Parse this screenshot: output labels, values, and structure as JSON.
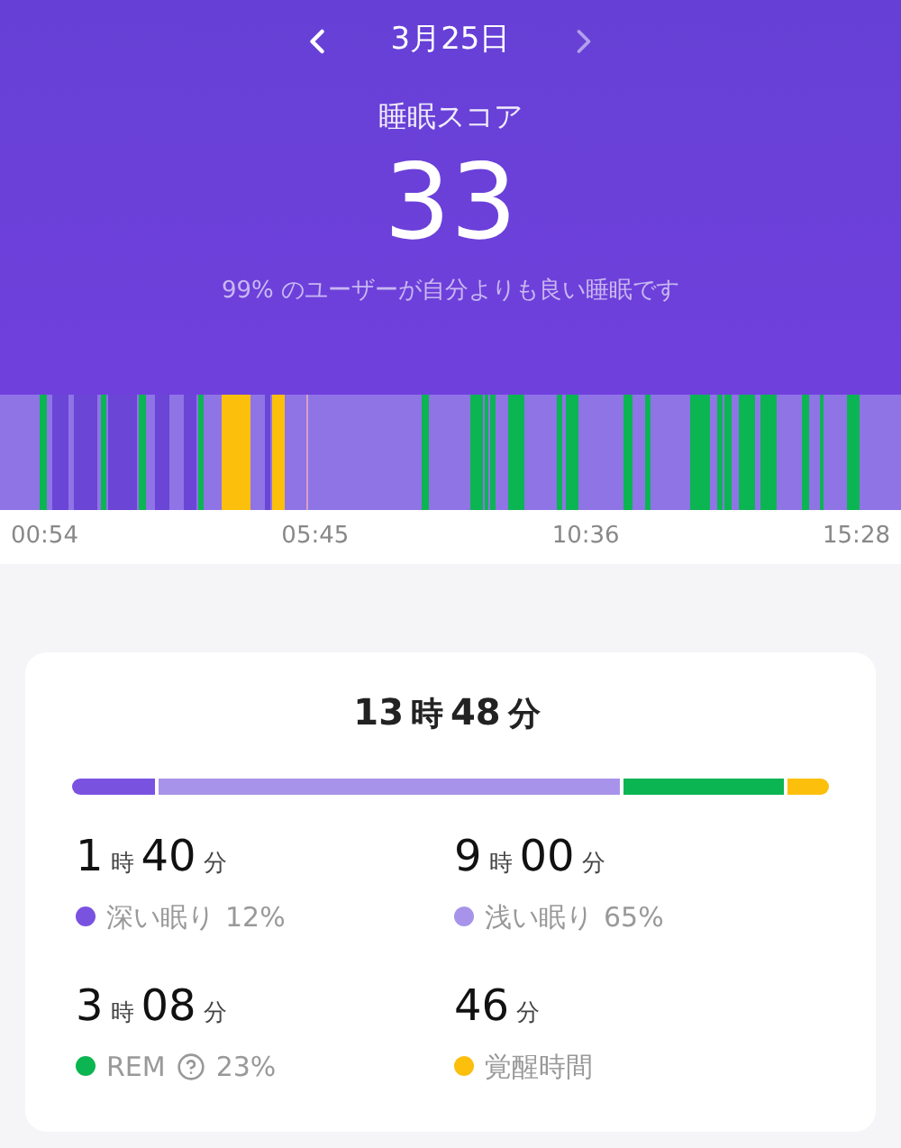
{
  "header": {
    "date": "3月25日",
    "score_label": "睡眠スコア",
    "score": "33",
    "comparison": "99% のユーザーが自分よりも良い睡眠です"
  },
  "timeline": {
    "times": [
      "00:54",
      "05:45",
      "10:36",
      "15:28"
    ]
  },
  "summary": {
    "total": [
      {
        "kind": "number",
        "text": "13"
      },
      {
        "kind": "unit",
        "text": "時"
      },
      {
        "kind": "number",
        "text": "48"
      },
      {
        "kind": "unit",
        "text": "分"
      }
    ],
    "stages": [
      {
        "name": "深い眠り",
        "percent": "12%",
        "color": "#7a52e0",
        "help": false,
        "duration": [
          {
            "kind": "number",
            "text": "1"
          },
          {
            "kind": "unit",
            "text": "時"
          },
          {
            "kind": "number",
            "text": "40"
          },
          {
            "kind": "unit",
            "text": "分"
          }
        ]
      },
      {
        "name": "浅い眠り",
        "percent": "65%",
        "color": "#a794ea",
        "help": false,
        "duration": [
          {
            "kind": "number",
            "text": "9"
          },
          {
            "kind": "unit",
            "text": "時"
          },
          {
            "kind": "number",
            "text": "00"
          },
          {
            "kind": "unit",
            "text": "分"
          }
        ]
      },
      {
        "name": "REM",
        "percent": "23%",
        "color": "#0bb552",
        "help": true,
        "duration": [
          {
            "kind": "number",
            "text": "3"
          },
          {
            "kind": "unit",
            "text": "時"
          },
          {
            "kind": "number",
            "text": "08"
          },
          {
            "kind": "unit",
            "text": "分"
          }
        ]
      },
      {
        "name": "覚醒時間",
        "color": "#fbbf0c",
        "help": false,
        "duration": [
          {
            "kind": "number",
            "text": "46"
          },
          {
            "kind": "unit",
            "text": "分"
          }
        ]
      }
    ]
  }
}
